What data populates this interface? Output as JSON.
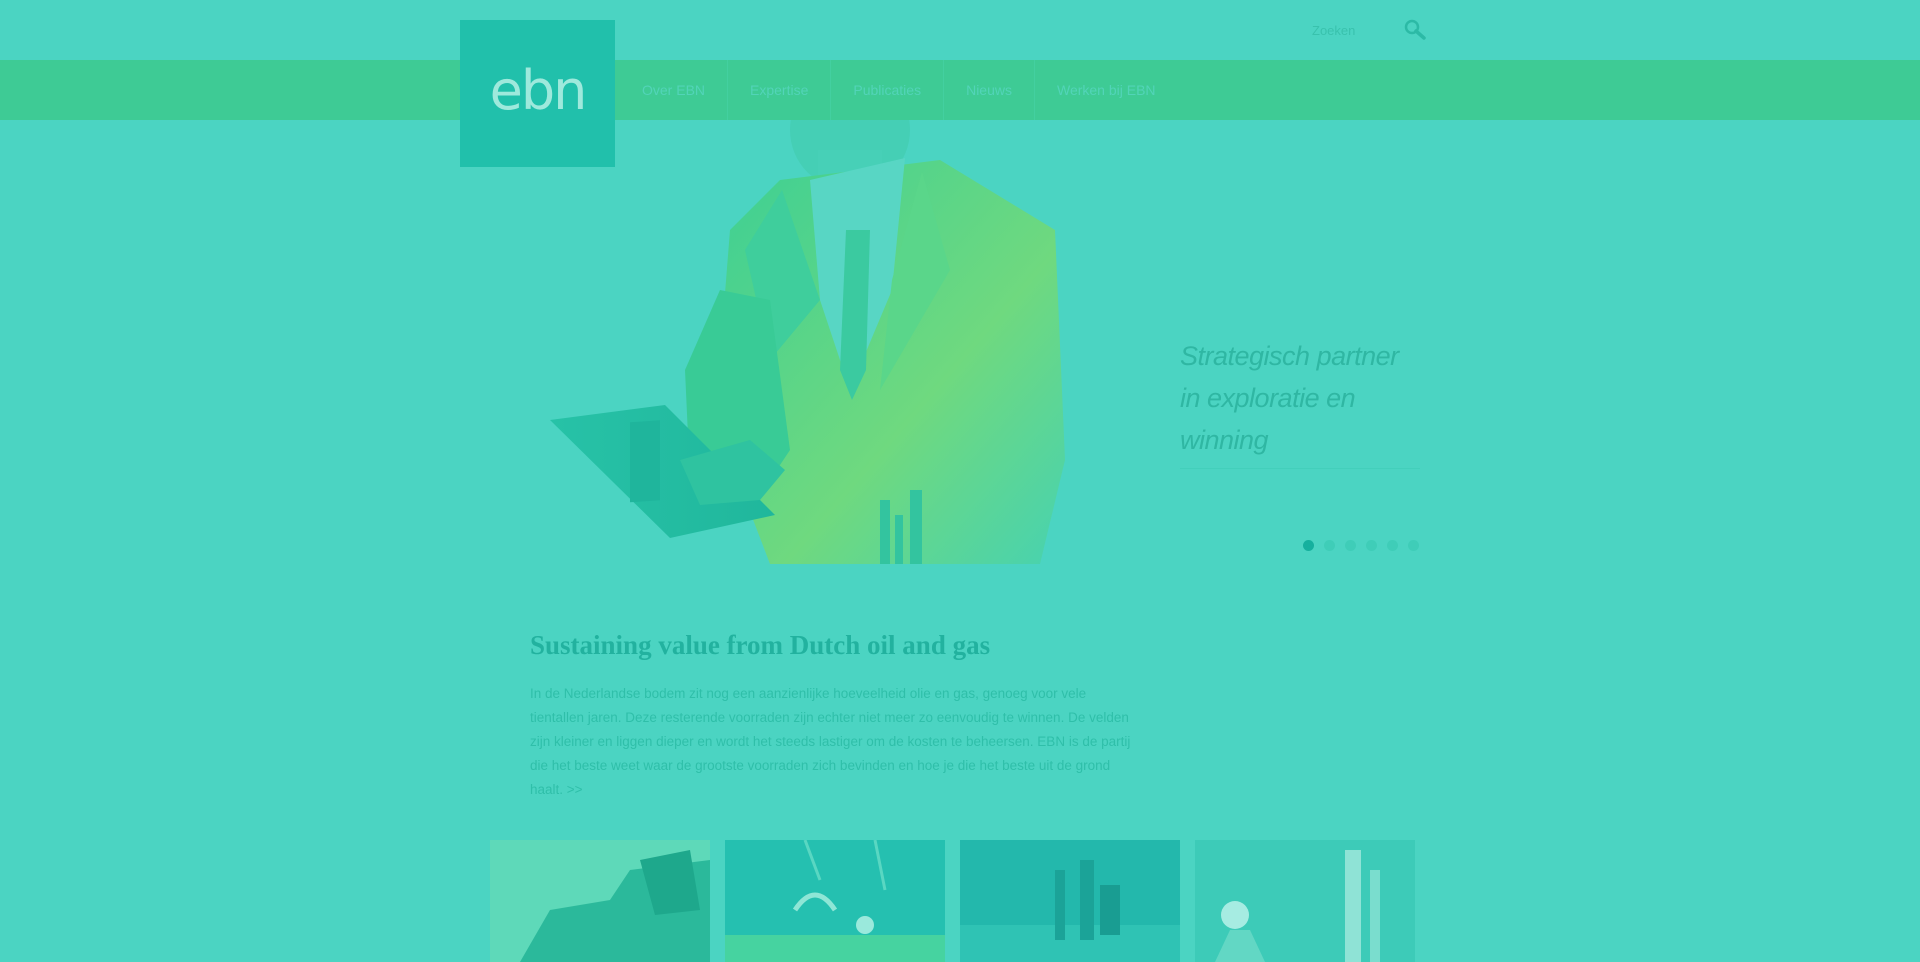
{
  "header": {
    "logo_text": "ebn",
    "search_placeholder": "Zoeken"
  },
  "nav": {
    "items": [
      {
        "label": "Over EBN"
      },
      {
        "label": "Expertise"
      },
      {
        "label": "Publicaties"
      },
      {
        "label": "Nieuws"
      },
      {
        "label": "Werken bij EBN"
      }
    ]
  },
  "hero": {
    "tagline_lines": [
      "Strategisch partner",
      "in exploratie en",
      "winning"
    ],
    "slides": 6,
    "active_slide": 1
  },
  "intro": {
    "title": "Sustaining value from Dutch oil and gas",
    "body": "In de Nederlandse bodem zit nog een aanzienlijke hoeveelheid olie en gas, genoeg voor vele tientallen jaren. Deze resterende voorraden zijn echter niet meer zo eenvoudig te winnen. De velden zijn kleiner en liggen dieper en wordt het steeds lastiger om de kosten te beheersen. EBN is de partij die het beste weet waar de grootste voorraden zich bevinden en hoe je die het beste uit de grond haalt. >>"
  },
  "colors": {
    "overlay": "#4bd4c2",
    "nav_band": "#3ecb95",
    "logo_bg": "#21c0ab",
    "accent": "#16b09e"
  }
}
